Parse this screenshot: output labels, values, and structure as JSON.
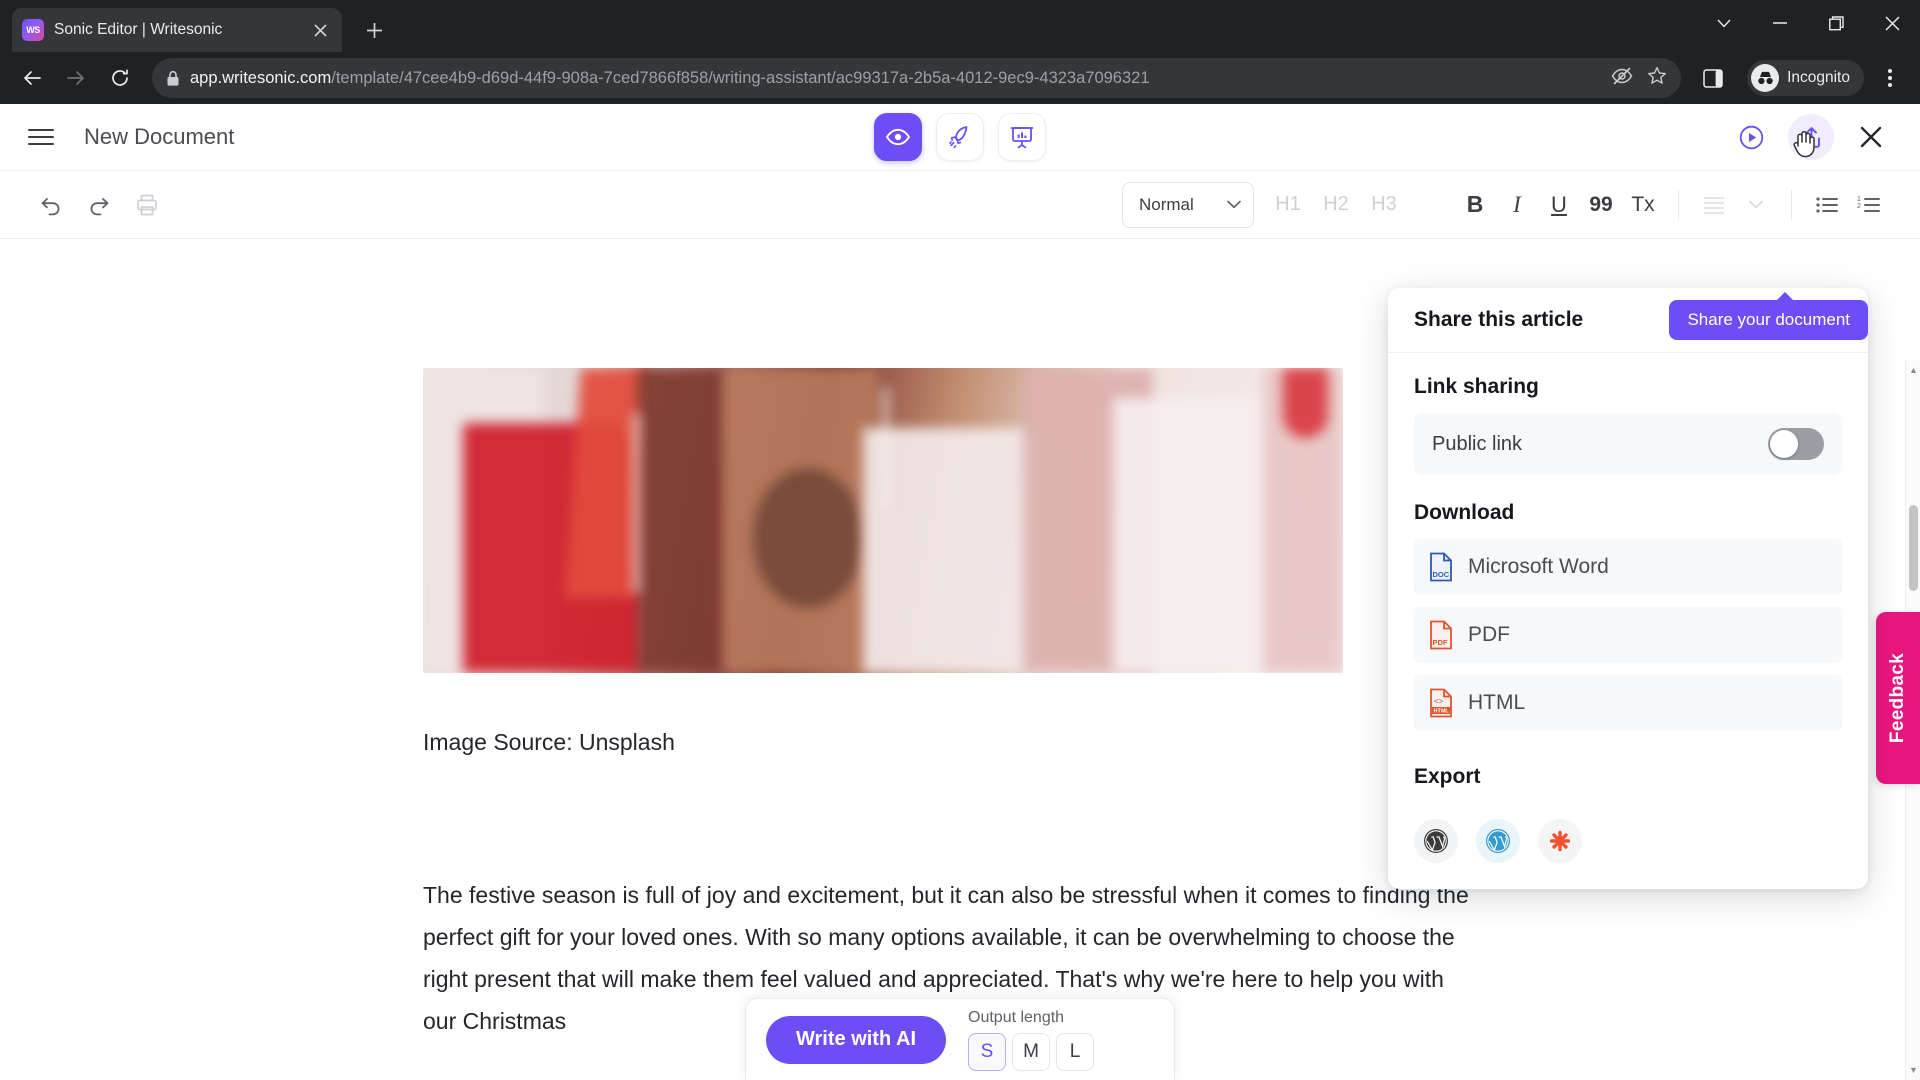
{
  "browser": {
    "tab": {
      "title": "Sonic Editor | Writesonic",
      "favicon_label": "WS"
    },
    "new_tab_label": "+",
    "url": {
      "host": "app.writesonic.com",
      "path": "/template/47cee4b9-d69d-44f9-908a-7ced7866f858/writing-assistant/ac99317a-2b5a-4012-9ec9-4323a7096321"
    },
    "profile_label": "Incognito"
  },
  "app": {
    "document_title": "New Document",
    "center_tools": [
      {
        "name": "preview",
        "icon": "eye-icon",
        "active": true
      },
      {
        "name": "boost",
        "icon": "rocket-icon",
        "active": false
      },
      {
        "name": "analytics",
        "icon": "presentation-chart-icon",
        "active": false
      }
    ],
    "header_right": [
      {
        "name": "play",
        "icon": "play-circle-icon"
      },
      {
        "name": "share",
        "icon": "share-upload-icon"
      },
      {
        "name": "close",
        "icon": "close-icon"
      }
    ]
  },
  "toolbar": {
    "undo": "undo-icon",
    "redo": "redo-icon",
    "print": "print-icon",
    "style_value": "Normal",
    "headings": [
      "H1",
      "H2",
      "H3"
    ],
    "bold": "B",
    "italic": "I",
    "underline": "U",
    "quote": "99",
    "clear_format": "Tx",
    "align": "align-icon",
    "align_caret": "chevron-down-icon",
    "bullet_list": "bullet-list-icon",
    "numbered_list": "numbered-list-icon"
  },
  "document": {
    "caption": "Image Source: Unsplash",
    "body": " The festive season is full of joy and excitement, but it can also be stressful when it comes to finding the perfect gift for your loved ones. With so many options available, it can be overwhelming to choose the right present that will make them feel valued and appreciated. That's why we're here to help you with our Christmas"
  },
  "share_panel": {
    "header": "Share this article",
    "link_sharing": {
      "title": "Link sharing",
      "row_label": "Public link",
      "toggle_on": false
    },
    "download": {
      "title": "Download",
      "items": [
        {
          "label": "Microsoft Word",
          "icon": "doc-file-icon",
          "color": "#2b5bb5"
        },
        {
          "label": "PDF",
          "icon": "pdf-file-icon",
          "color": "#e0542f"
        },
        {
          "label": "HTML",
          "icon": "html-file-icon",
          "color": "#e0542f"
        }
      ]
    },
    "export": {
      "title": "Export",
      "items": [
        {
          "name": "wordpress-dark",
          "icon": "wordpress-icon",
          "color": "#3b3b3b"
        },
        {
          "name": "wordpress-blue",
          "icon": "wordpress-icon",
          "color": "#3499cd"
        },
        {
          "name": "webflow-burst",
          "icon": "asterisk-burst-icon",
          "color": "#f4522e"
        }
      ]
    }
  },
  "tooltip": {
    "text": "Share your document"
  },
  "feedback": {
    "label": "Feedback",
    "color": "#e8177e"
  },
  "ai_bar": {
    "write_button": "Write with AI",
    "output_length_label": "Output length",
    "options": [
      "S",
      "M",
      "L"
    ],
    "selected": "S"
  },
  "colors": {
    "accent": "#6c4df6",
    "chrome_bg": "#202124",
    "chrome_surface": "#35363a",
    "feedback_pink": "#e8177e"
  }
}
